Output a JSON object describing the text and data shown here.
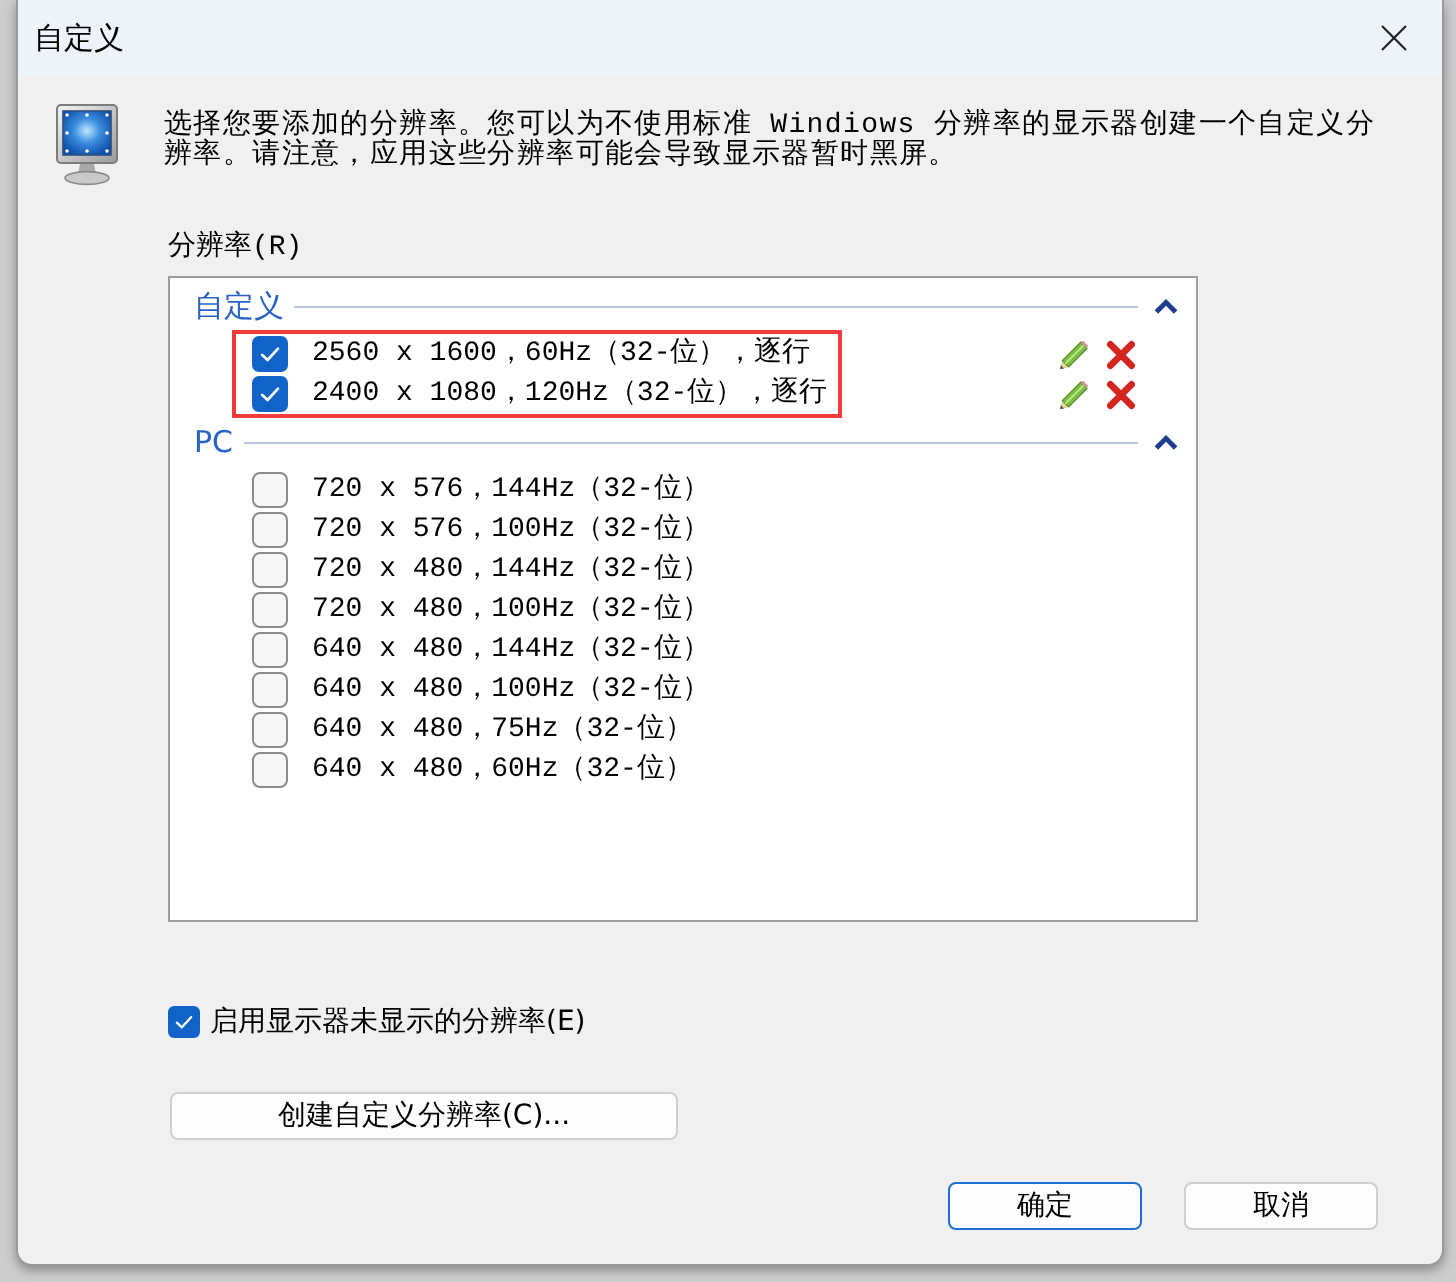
{
  "window": {
    "title": "自定义"
  },
  "description": "选择您要添加的分辨率。您可以为不使用标准 Windiows 分辨率的显示器创建一个自定义分辨率。请注意，应用这些分辨率可能会导致显示器暂时黑屏。",
  "list": {
    "label": "分辨率(R)",
    "groups": [
      {
        "name": "自定义",
        "expanded": true,
        "highlighted": true,
        "items": [
          {
            "text": "2560 x 1600，60Hz（32-位），逐行",
            "checked": true,
            "editable": true
          },
          {
            "text": "2400 x 1080，120Hz（32-位），逐行",
            "checked": true,
            "editable": true
          }
        ]
      },
      {
        "name": "PC",
        "expanded": true,
        "highlighted": false,
        "items": [
          {
            "text": "720 x 576，144Hz（32-位）",
            "checked": false,
            "editable": false
          },
          {
            "text": "720 x 576，100Hz（32-位）",
            "checked": false,
            "editable": false
          },
          {
            "text": "720 x 480，144Hz（32-位）",
            "checked": false,
            "editable": false
          },
          {
            "text": "720 x 480，100Hz（32-位）",
            "checked": false,
            "editable": false
          },
          {
            "text": "640 x 480，144Hz（32-位）",
            "checked": false,
            "editable": false
          },
          {
            "text": "640 x 480，100Hz（32-位）",
            "checked": false,
            "editable": false
          },
          {
            "text": "640 x 480，75Hz（32-位）",
            "checked": false,
            "editable": false
          },
          {
            "text": "640 x 480，60Hz（32-位）",
            "checked": false,
            "editable": false
          }
        ]
      }
    ]
  },
  "show_unlisted": {
    "label": "启用显示器未显示的分辨率(E)",
    "checked": true
  },
  "create_button": "创建自定义分辨率(C)...",
  "buttons": [
    {
      "label": "确定",
      "default": true
    },
    {
      "label": "取消",
      "default": false
    }
  ]
}
